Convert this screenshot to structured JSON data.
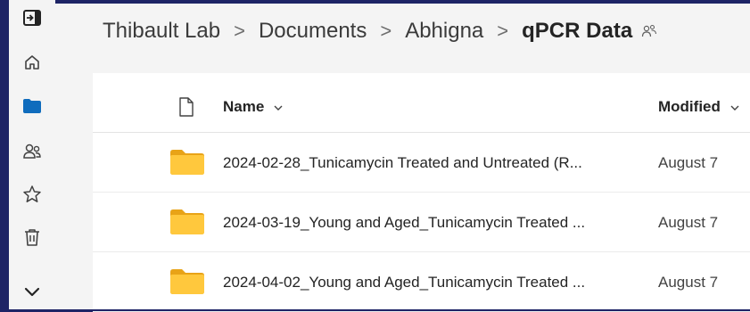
{
  "rail": {
    "items": [
      {
        "name": "collapse-pane-icon"
      },
      {
        "name": "home-icon"
      },
      {
        "name": "folder-icon"
      },
      {
        "name": "people-icon"
      },
      {
        "name": "star-icon"
      },
      {
        "name": "trash-icon"
      },
      {
        "name": "chevron-down-icon"
      }
    ],
    "accent": "#0f6cbd"
  },
  "breadcrumb": {
    "items": [
      "Thibault Lab",
      "Documents",
      "Abhigna"
    ],
    "current": "qPCR Data",
    "separator": ">"
  },
  "list": {
    "columns": {
      "name": "Name",
      "modified": "Modified"
    },
    "rows": [
      {
        "name": "2024-02-28_Tunicamycin Treated and Untreated (R...",
        "modified": "August 7"
      },
      {
        "name": "2024-03-19_Young and Aged_Tunicamycin Treated ...",
        "modified": "August 7"
      },
      {
        "name": "2024-04-02_Young and Aged_Tunicamycin Treated ...",
        "modified": "August 7"
      }
    ]
  },
  "colors": {
    "frame": "#1e2466",
    "folder_front": "#ffc83d",
    "folder_back": "#e8a317"
  }
}
